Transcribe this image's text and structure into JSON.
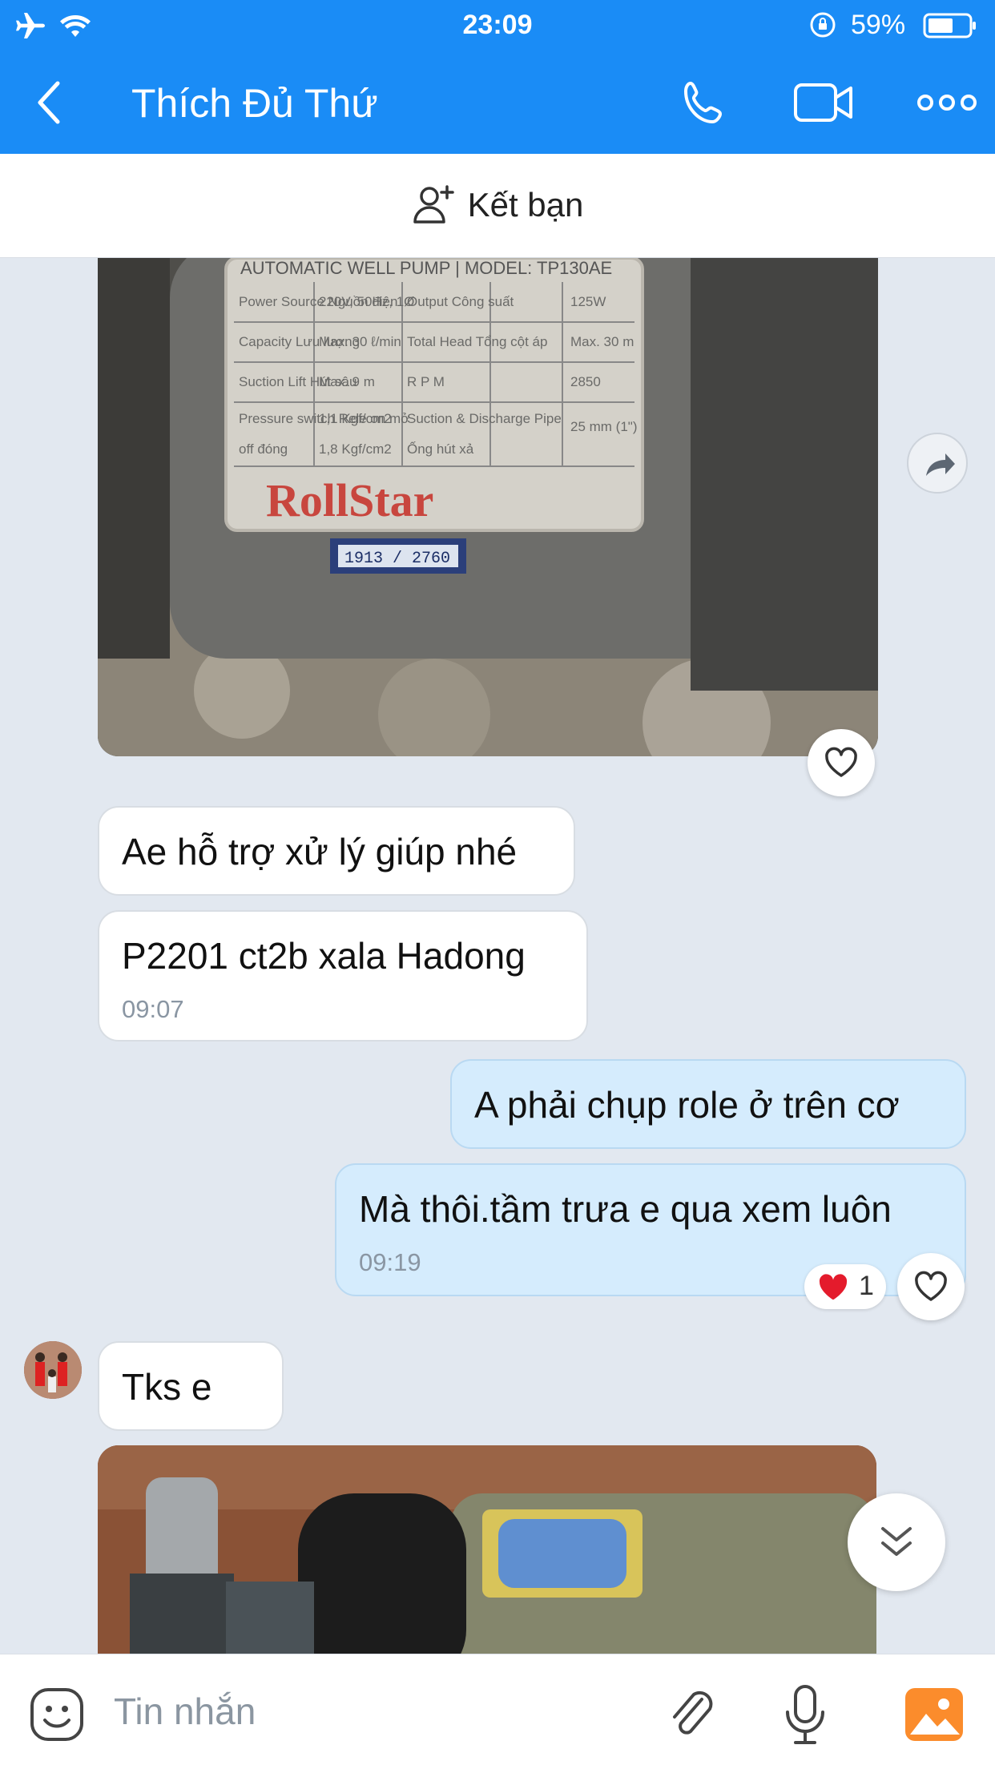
{
  "status": {
    "time": "23:09",
    "battery": "59%"
  },
  "header": {
    "title": "Thích Đủ Thứ"
  },
  "add_friend": {
    "label": "Kết bạn"
  },
  "messages": [
    {
      "text": "Ae hỗ trợ xử lý giúp nhé"
    },
    {
      "text": "P2201 ct2b xala Hadong",
      "time": "09:07"
    },
    {
      "text": "A phải chụp role ở trên cơ"
    },
    {
      "text": "Mà thôi.tầm trưa e qua xem luôn",
      "time": "09:19"
    },
    {
      "text": "Tks e"
    }
  ],
  "reaction": {
    "count": "1"
  },
  "photo1": {
    "brand": "RollStar",
    "plate_header": "AUTOMATIC WELL PUMP | MODEL: TP130AE",
    "serial": "1913 / 2760",
    "rows": [
      [
        "Power Source Nguồn điện",
        "220V, 50Hz, 1Ø",
        "Output Công suất",
        "125W"
      ],
      [
        "Capacity Lưu lượng",
        "Max. 30 ℓ/min",
        "Total Head Tổng cột áp",
        "Max. 30 m"
      ],
      [
        "Suction Lift Hút sâu",
        "Max. 9 m",
        "R P M",
        "2850"
      ],
      [
        "Pressure switch Rele on mở",
        "1,1 Kgf/cm2",
        "Suction & Discharge Pipe",
        "25 mm (1\")"
      ],
      [
        "off đóng",
        "1,8 Kgf/cm2",
        "Ống hút xả",
        ""
      ]
    ]
  },
  "input": {
    "placeholder": "Tin nhắn"
  },
  "colors": {
    "accent": "#1a8cf6",
    "out_bubble": "#d5ecfd",
    "background": "#e2e8f0"
  },
  "icons": [
    "airplane-icon",
    "wifi-icon",
    "rotation-lock-icon",
    "battery-icon",
    "back-icon",
    "phone-icon",
    "video-icon",
    "more-icon",
    "add-friend-icon",
    "share-icon",
    "heart-icon",
    "chevron-double-down-icon",
    "emoji-icon",
    "attach-icon",
    "mic-icon",
    "gallery-icon"
  ]
}
